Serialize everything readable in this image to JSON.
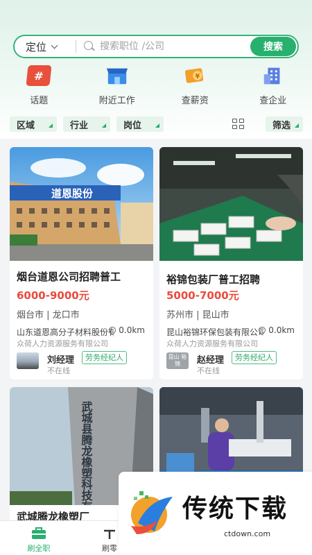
{
  "search": {
    "location_label": "定位",
    "placeholder": "搜索职位 /公司",
    "button_label": "搜索"
  },
  "quick_entries": [
    {
      "label": "话题",
      "icon": "hash-icon",
      "color": "#e8503c"
    },
    {
      "label": "附近工作",
      "icon": "store-icon",
      "color": "#3b8de8"
    },
    {
      "label": "查薪资",
      "icon": "salary-icon",
      "color": "#f2a02a"
    },
    {
      "label": "查企业",
      "icon": "building-icon",
      "color": "#5b7fe0"
    }
  ],
  "filters": {
    "area": "区域",
    "industry": "行业",
    "position": "岗位",
    "screen": "筛选"
  },
  "jobs": [
    {
      "title": "烟台道恩公司招聘普工",
      "salary": "6000-9000元",
      "location": "烟台市 | 龙口市",
      "company": "山东道恩高分子材料股份有限公司",
      "distance": "0.0km",
      "agency": "众荷人力资源服务有限公司",
      "recruiter": "刘经理",
      "tag": "劳务经纪人",
      "status": "不在线",
      "sign_text": "道恩股份"
    },
    {
      "title": "裕锦包装厂普工招聘",
      "salary": "5000-7000元",
      "location": "苏州市 | 昆山市",
      "company": "昆山裕锦环保包装有限公司",
      "distance": "0.0km",
      "agency": "众荷人力资源服务有限公司",
      "recruiter": "赵经理",
      "tag": "劳务经纪人",
      "status": "不在线",
      "avatar_text": "昆山 裕锦"
    },
    {
      "title": "武城腾龙橡塑厂",
      "sign_text": "武城县腾龙橡塑科技有限公司"
    },
    {
      "title": ""
    }
  ],
  "tabs": [
    {
      "label": "刷全职"
    },
    {
      "label": "刷零"
    }
  ],
  "promo": {
    "title": "传统下载",
    "url": "ctdown.com"
  },
  "colors": {
    "accent": "#27b06e",
    "salary": "#e94b3c"
  }
}
